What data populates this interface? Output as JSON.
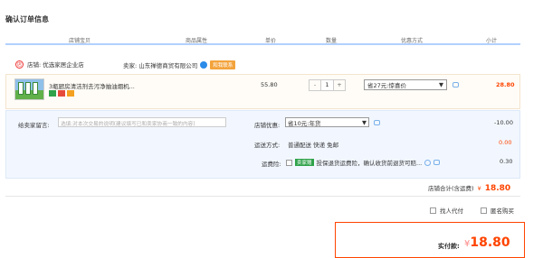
{
  "page": {
    "title": "确认订单信息"
  },
  "columns": [
    "店铺宝贝",
    "商品属性",
    "单价",
    "数量",
    "优惠方式",
    "小计"
  ],
  "store": {
    "label": "店铺: 优选家居企业店",
    "seller_label": "卖家: 山东禅德商贸有限公司",
    "contact": "和我联系"
  },
  "item": {
    "name": "3瓶厨房清洁剂去污净抽油烟机...",
    "price": "55.80",
    "quantity": "1",
    "minus": "-",
    "plus": "+",
    "promo": "省27元:惊喜价",
    "subtotal": "28.80"
  },
  "message": {
    "label": "给卖家留言:",
    "placeholder": "选填:对本次交易的说明(建议填写已和卖家协商一致的内容)"
  },
  "store_promo": {
    "label": "店铺优惠:",
    "value": "省10元:年货",
    "amount": "-10.00"
  },
  "shipping": {
    "label": "运送方式:",
    "value": "普通配送 快递 免邮",
    "amount": "0.00"
  },
  "insurance": {
    "label": "运费险:",
    "tag": "卖家赠",
    "text": "投保退货运费险，确认收货前退货可赔...",
    "amount": "0.30"
  },
  "store_total": {
    "label": "店铺合计(含运费)",
    "currency": "¥",
    "amount": "18.80"
  },
  "options": {
    "anonymous_pay": "找人代付",
    "anonymous_buy": "匿名购买"
  },
  "pay": {
    "label": "实付款:",
    "currency": "¥",
    "amount": "18.80"
  },
  "colors": {
    "accent": "#ff4400",
    "header_line": "#b2d1ff",
    "contact": "#f3a33c"
  },
  "icons": [
    "store-icon",
    "wangwang-icon",
    "chat-icon",
    "question-icon",
    "checkbox-icon"
  ]
}
